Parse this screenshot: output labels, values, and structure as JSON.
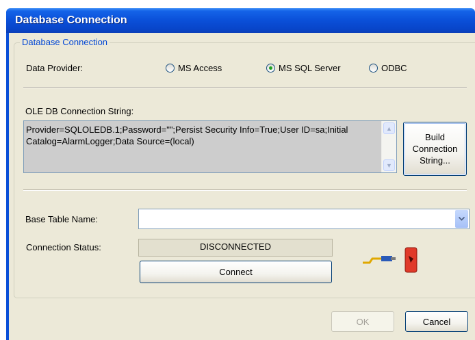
{
  "window": {
    "title": "Database Connection"
  },
  "group": {
    "legend": "Database Connection"
  },
  "data_provider": {
    "label": "Data Provider:",
    "options": [
      {
        "label": "MS Access",
        "selected": false
      },
      {
        "label": "MS SQL Server",
        "selected": true
      },
      {
        "label": "ODBC",
        "selected": false
      }
    ]
  },
  "connection_string": {
    "label": "OLE DB Connection String:",
    "value": "Provider=SQLOLEDB.1;Password=\"\";Persist Security Info=True;User ID=sa;Initial Catalog=AlarmLogger;Data Source=(local)",
    "build_button": {
      "line1": "Build",
      "line2": "Connection",
      "line3": "String..."
    }
  },
  "base_table": {
    "label": "Base Table Name:",
    "value": ""
  },
  "connection_status": {
    "label": "Connection Status:",
    "value": "DISCONNECTED"
  },
  "connect_button": "Connect",
  "footer": {
    "ok": "OK",
    "cancel": "Cancel"
  },
  "icons": {
    "status_icon": "plug-disconnected-icon",
    "combo_arrow": "chevron-down-icon"
  },
  "colors": {
    "titlebar": "#0a4fd8",
    "group_legend": "#0046d5",
    "dialog_bg": "#ece9d8"
  }
}
